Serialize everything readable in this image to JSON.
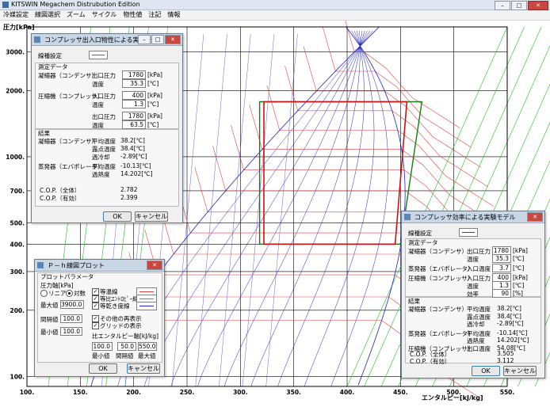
{
  "window": {
    "title": "KITSWIN Megachem  Distrubution Edition",
    "buttons": [
      "–",
      "□",
      "✕"
    ]
  },
  "menu": [
    "冷媒設定",
    "線図選択",
    "ズーム",
    "サイクル",
    "物性値",
    "注記",
    "情報"
  ],
  "chart_data": {
    "type": "line",
    "ylabel": "圧力[kPa]",
    "xlabel": "エンタルピー[kJ/kg]",
    "yscale": "log",
    "xlim": [
      100,
      550
    ],
    "ylim": [
      90,
      3900
    ],
    "x_ticks": [
      "100.",
      "150.",
      "200.",
      "250.",
      "300.",
      "350.",
      "400.",
      "450.",
      "500.",
      "550."
    ],
    "y_ticks": [
      {
        "value": 3000,
        "label": "3000."
      },
      {
        "value": 2000,
        "label": "2000."
      },
      {
        "value": 1000,
        "label": "1000."
      },
      {
        "value": 700,
        "label": "700."
      },
      {
        "value": 500,
        "label": "500."
      },
      {
        "value": 400,
        "label": "400."
      },
      {
        "value": 300,
        "label": "300."
      },
      {
        "value": 200,
        "label": "200."
      },
      {
        "value": 100,
        "label": "100."
      }
    ],
    "grid": true,
    "colors": {
      "saturation": "#2020c0",
      "isotherm": "#e04040",
      "isentrope": "#20c020",
      "cycle": "#d01010",
      "compression": "#108010"
    },
    "cycle_points": [
      {
        "h": 318,
        "p": 1780
      },
      {
        "h": 470,
        "p": 1780
      },
      {
        "h": 450,
        "p": 400
      },
      {
        "h": 318,
        "p": 400
      }
    ],
    "cycle2_points": [
      {
        "h": 322,
        "p": 1780
      },
      {
        "h": 456,
        "p": 1780
      },
      {
        "h": 445,
        "p": 400
      },
      {
        "h": 322,
        "p": 400
      }
    ]
  },
  "dlg1": {
    "title": "コンプレッサ出入口物性による実験モデル",
    "line_setting": "線種設定",
    "measured": "測定データ",
    "rows": [
      {
        "group": "凝縮器（コンデンサ）",
        "label": "出口圧力",
        "value": "1780",
        "unit": "[kPa]"
      },
      {
        "group": "",
        "label": "温度",
        "value": "35.3",
        "unit": "[℃]"
      },
      {
        "group": "圧縮機（コンプレッサ）",
        "label": "入口圧力",
        "value": "400",
        "unit": "[kPa]"
      },
      {
        "group": "",
        "label": "温度",
        "value": "1.3",
        "unit": "[℃]"
      },
      {
        "group": "",
        "label": "出口圧力",
        "value": "1780",
        "unit": "[kPa]"
      },
      {
        "group": "",
        "label": "温度",
        "value": "63.5",
        "unit": "[℃]"
      }
    ],
    "result_title": "結果",
    "results": [
      {
        "group": "凝縮器（コンデンサ）",
        "label": "平均温度",
        "value": "38.2[℃]"
      },
      {
        "group": "",
        "label": "露点温度",
        "value": "38.4[℃]"
      },
      {
        "group": "",
        "label": "過冷却",
        "value": "-2.89[℃]"
      },
      {
        "group": "蒸発器（エバポレータ）",
        "label": "平均温度",
        "value": "-10.13[℃]"
      },
      {
        "group": "",
        "label": "過熱度",
        "value": "14.202[℃]"
      }
    ],
    "cop": [
      {
        "label": "C.O.P.（全体）",
        "value": "2.782"
      },
      {
        "label": "C.O.P.（有効）",
        "value": "2.399"
      }
    ],
    "ok": "OK",
    "cancel": "キャンセル"
  },
  "dlg2": {
    "title": "コンプレッサ効率による実験モデル",
    "line_setting": "線種設定",
    "measured": "測定データ",
    "rows": [
      {
        "group": "凝縮器（コンデンサ）",
        "label": "出口圧力",
        "value": "1780",
        "unit": "[kPa]"
      },
      {
        "group": "",
        "label": "温度",
        "value": "35.3",
        "unit": "[℃]"
      },
      {
        "group": "蒸発器（エバポレータ）",
        "label": "入口温度",
        "value": "3.7",
        "unit": "[℃]"
      },
      {
        "group": "圧縮機（コンプレッサ）",
        "label": "入口圧力",
        "value": "400",
        "unit": "[kPa]"
      },
      {
        "group": "",
        "label": "温度",
        "value": "1.3",
        "unit": "[℃]"
      },
      {
        "group": "",
        "label": "効率",
        "value": "90",
        "unit": "[%]"
      }
    ],
    "result_title": "結果",
    "results": [
      {
        "group": "凝縮器（コンデンサ）",
        "label": "平均温度",
        "value": "38.2[℃]"
      },
      {
        "group": "",
        "label": "露点温度",
        "value": "38.4[℃]"
      },
      {
        "group": "",
        "label": "過冷却",
        "value": "-2.89[℃]"
      },
      {
        "group": "蒸発器（エバポレータ）",
        "label": "平均温度",
        "value": "-10.14[℃]"
      },
      {
        "group": "",
        "label": "過熱度",
        "value": "14.202[℃]"
      },
      {
        "group": "圧縮機（コンプレッサ）",
        "label": "出口温度",
        "value": "54.08[℃]"
      }
    ],
    "cop": [
      {
        "label": "C.O.P.（全体）",
        "value": "3.505"
      },
      {
        "label": "C.O.P.（有効）",
        "value": "3.112"
      }
    ],
    "ok": "OK",
    "cancel": "キャンセル"
  },
  "dlg3": {
    "title": "Ｐ－ｈ線図プロット",
    "group_title": "プロットパラメータ",
    "axis_label": "圧力軸[kPa]",
    "linear": "リニア",
    "log": "対数",
    "max_label": "最大値",
    "max_value": "3900.0",
    "step_label": "間隔値",
    "step_value": "100.0",
    "min_label": "最小値",
    "min_value": "100.0",
    "checks": [
      {
        "label": "等温線",
        "checked": true
      },
      {
        "label": "等比ｴﾝﾄﾛﾋﾟｰ線",
        "checked": true
      },
      {
        "label": "等乾き度線",
        "checked": true
      },
      {
        "label": "その他の再表示",
        "checked": true
      },
      {
        "label": "グリッドの表示",
        "checked": true
      }
    ],
    "enthalpy_label": "比エンタルピー軸[kJ/kg]",
    "enthalpy_min": "100.0",
    "enthalpy_step": "50.0",
    "enthalpy_max": "550.0",
    "enthalpy_min_label": "最小値",
    "enthalpy_step_label": "間隔値",
    "enthalpy_max_label": "最大値",
    "ok": "OK",
    "cancel": "キャンセル"
  }
}
